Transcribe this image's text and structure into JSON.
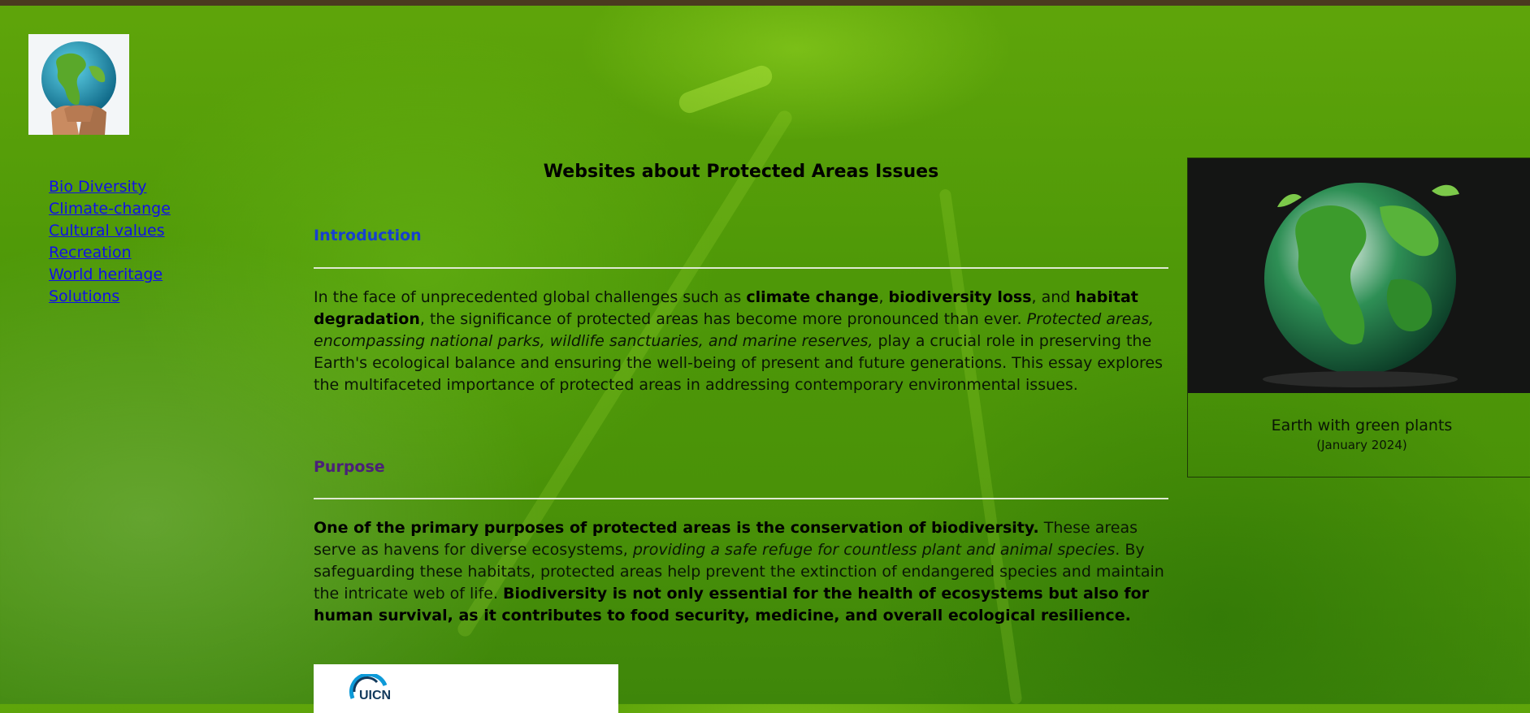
{
  "page": {
    "title": "Websites about Protected Areas Issues"
  },
  "nav": {
    "items": [
      {
        "label": "Bio Diversity"
      },
      {
        "label": "Climate-change"
      },
      {
        "label": "Cultural values"
      },
      {
        "label": "Recreation"
      },
      {
        "label": "World heritage"
      },
      {
        "label": "Solutions"
      }
    ]
  },
  "sections": {
    "introduction": {
      "title": "Introduction",
      "parts": {
        "t1": "In the face of unprecedented global challenges such as ",
        "b1": "climate change",
        "t2": ", ",
        "b2": "biodiversity loss",
        "t3": ", and ",
        "b3": "habitat degradation",
        "t4": ", the significance of protected areas has become more pronounced than ever. ",
        "i1": "Protected areas, encompassing national parks, wildlife sanctuaries, and marine reserves,",
        "t5": " play a crucial role in preserving the Earth's ecological balance and ensuring the well-being of present and future generations. This essay explores the multifaceted importance of protected areas in addressing contemporary environmental issues."
      }
    },
    "purpose": {
      "title": "Purpose",
      "parts": {
        "b1": "One of the primary purposes of protected areas is the conservation of biodiversity.",
        "t1": " These areas serve as havens for diverse ecosystems, ",
        "i1": "providing a safe refuge for countless plant and animal species",
        "t2": ". By safeguarding these habitats, protected areas help prevent the extinction of endangered species and maintain the intricate web of life. ",
        "b2": "Biodiversity is not only essential for the health of ecosystems but also for human survival, as it contributes to food security, medicine, and overall ecological resilience."
      }
    }
  },
  "figure": {
    "caption": "Earth with green plants",
    "date": "(January 2024)"
  },
  "logo_strip": {
    "text": "UICN"
  },
  "icons": {
    "logo": "hands-holding-globe-icon",
    "figure": "green-earth-icon",
    "uicn": "uicn-logo-icon"
  },
  "colors": {
    "link": "#1010e8",
    "intro_heading": "#1740cf",
    "purpose_heading": "#4b2079",
    "topbar": "#4a3a1f"
  }
}
